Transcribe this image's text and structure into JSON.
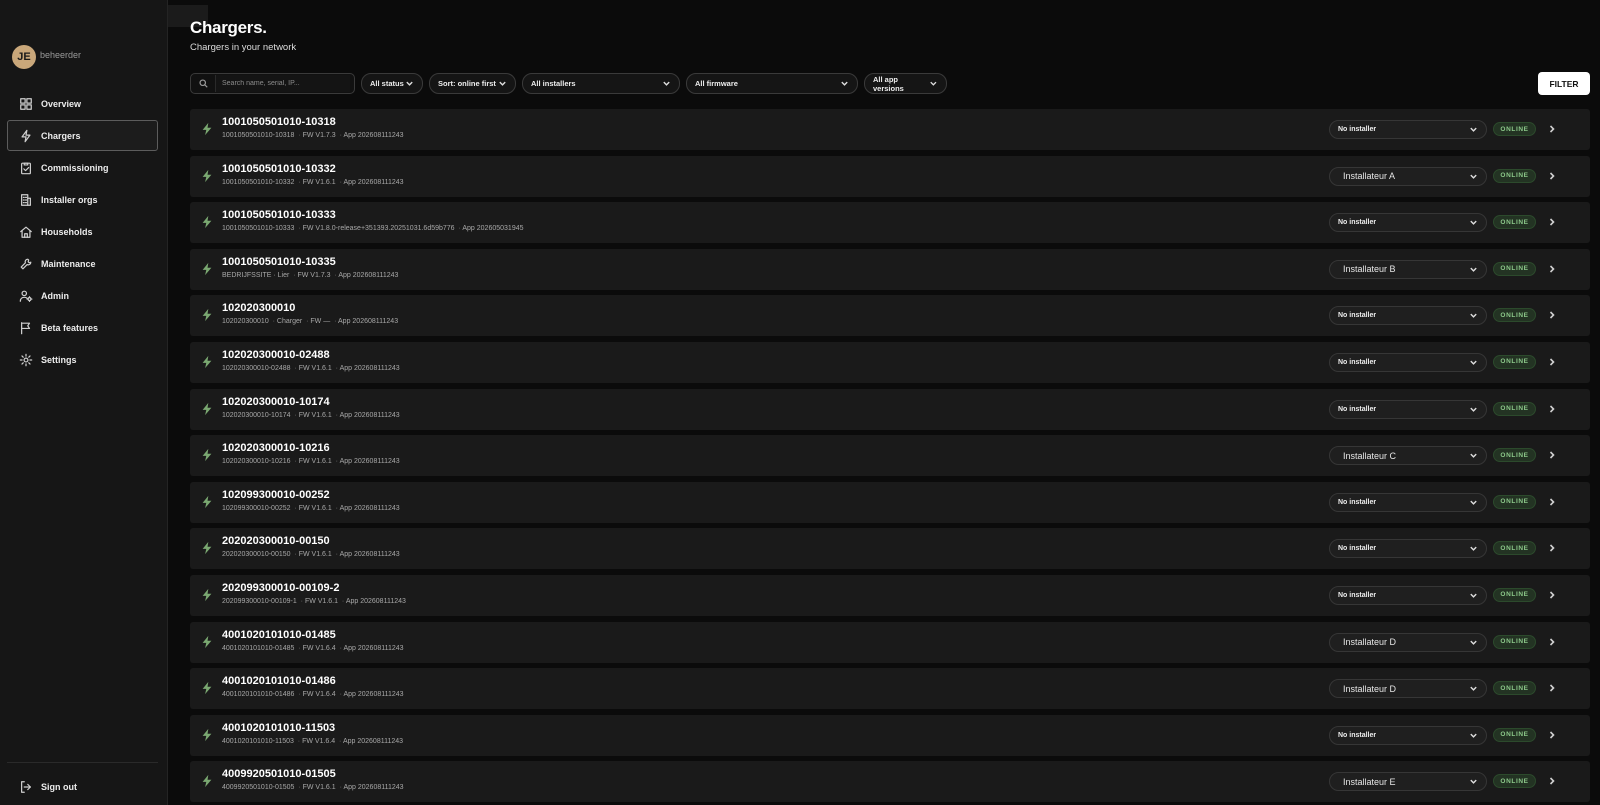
{
  "user": {
    "initials": "JE",
    "name": "beheerder"
  },
  "nav": [
    {
      "id": "overview",
      "label": "Overview",
      "icon": "grid-icon"
    },
    {
      "id": "chargers",
      "label": "Chargers",
      "icon": "bolt-icon",
      "active": true
    },
    {
      "id": "commissioning",
      "label": "Commissioning",
      "icon": "clipboard-check-icon"
    },
    {
      "id": "installer-orgs",
      "label": "Installer orgs",
      "icon": "building-icon"
    },
    {
      "id": "households",
      "label": "Households",
      "icon": "home-icon"
    },
    {
      "id": "maintenance",
      "label": "Maintenance",
      "icon": "wrench-icon"
    },
    {
      "id": "admin",
      "label": "Admin",
      "icon": "users-gear-icon"
    },
    {
      "id": "beta-features",
      "label": "Beta features",
      "icon": "flag-icon"
    },
    {
      "id": "settings",
      "label": "Settings",
      "icon": "gear-icon"
    }
  ],
  "signout": {
    "label": "Sign out",
    "icon": "logout-icon"
  },
  "page": {
    "title": "Chargers.",
    "subtitle": "Chargers in your network"
  },
  "toolbar": {
    "search_placeholder": "Search name, serial, IP...",
    "filters": [
      "All status",
      "Sort: online first",
      "All installers",
      "All firmware",
      "All app versions"
    ],
    "filter_button": "FILTER"
  },
  "separator": "·",
  "chargers": [
    {
      "name": "1001050501010-10318",
      "meta": [
        "1001050501010-10318",
        "FW V1.7.3",
        "App 202608111243"
      ],
      "installer": "No installer",
      "status": "ONLINE"
    },
    {
      "name": "1001050501010-10332",
      "meta": [
        "1001050501010-10332",
        "FW V1.6.1",
        "App 202608111243"
      ],
      "installer": "Installateur A",
      "status": "ONLINE"
    },
    {
      "name": "1001050501010-10333",
      "meta": [
        "1001050501010-10333",
        "FW V1.8.0-release+351393.20251031.6d59b776",
        "App 202605031945"
      ],
      "installer": "No installer",
      "status": "ONLINE"
    },
    {
      "name": "1001050501010-10335",
      "meta": [
        "BEDRIJFSSITE · Lier",
        "FW V1.7.3",
        "App 202608111243"
      ],
      "installer": "Installateur B",
      "status": "ONLINE"
    },
    {
      "name": "102020300010",
      "meta": [
        "102020300010",
        "Charger",
        "FW —",
        "App 202608111243"
      ],
      "installer": "No installer",
      "status": "ONLINE"
    },
    {
      "name": "102020300010-02488",
      "meta": [
        "102020300010-02488",
        "FW V1.6.1",
        "App 202608111243"
      ],
      "installer": "No installer",
      "status": "ONLINE"
    },
    {
      "name": "102020300010-10174",
      "meta": [
        "102020300010-10174",
        "FW V1.6.1",
        "App 202608111243"
      ],
      "installer": "No installer",
      "status": "ONLINE"
    },
    {
      "name": "102020300010-10216",
      "meta": [
        "102020300010-10216",
        "FW V1.6.1",
        "App 202608111243"
      ],
      "installer": "Installateur C",
      "status": "ONLINE"
    },
    {
      "name": "102099300010-00252",
      "meta": [
        "102099300010-00252",
        "FW V1.6.1",
        "App 202608111243"
      ],
      "installer": "No installer",
      "status": "ONLINE"
    },
    {
      "name": "202020300010-00150",
      "meta": [
        "202020300010-00150",
        "FW V1.6.1",
        "App 202608111243"
      ],
      "installer": "No installer",
      "status": "ONLINE"
    },
    {
      "name": "202099300010-00109-2",
      "meta": [
        "202099300010-00109-1",
        "FW V1.6.1",
        "App 202608111243"
      ],
      "installer": "No installer",
      "status": "ONLINE"
    },
    {
      "name": "4001020101010-01485",
      "meta": [
        "4001020101010-01485",
        "FW V1.6.4",
        "App 202608111243"
      ],
      "installer": "Installateur D",
      "status": "ONLINE"
    },
    {
      "name": "4001020101010-01486",
      "meta": [
        "4001020101010-01486",
        "FW V1.6.4",
        "App 202608111243"
      ],
      "installer": "Installateur D",
      "status": "ONLINE"
    },
    {
      "name": "4001020101010-11503",
      "meta": [
        "4001020101010-11503",
        "FW V1.6.4",
        "App 202608111243"
      ],
      "installer": "No installer",
      "status": "ONLINE"
    },
    {
      "name": "4009920501010-01505",
      "meta": [
        "4009920501010-01505",
        "FW V1.6.1",
        "App 202608111243"
      ],
      "installer": "Installateur E",
      "status": "ONLINE"
    }
  ],
  "colors": {
    "accent_green": "#7aa871",
    "online_text": "#8cc98a",
    "background": "#0b0b0b",
    "sidebar": "#161616"
  }
}
